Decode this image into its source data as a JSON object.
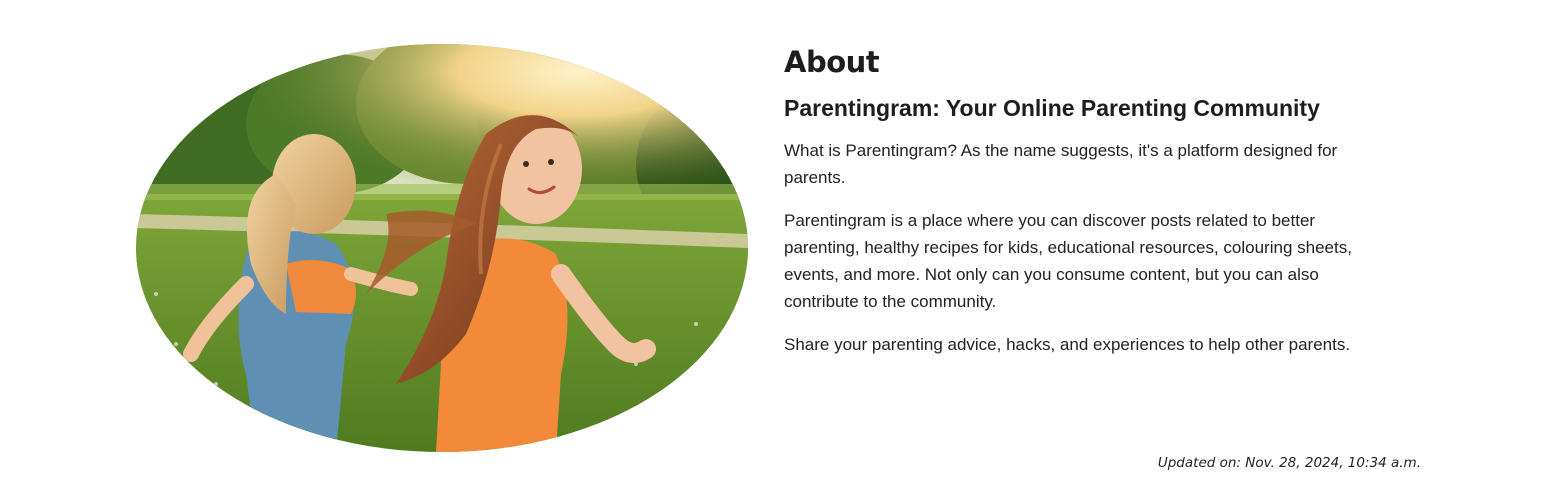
{
  "image": {
    "alt": "Two girls running on grass in a sunny park"
  },
  "about": {
    "heading": "About",
    "subheading": "Parentingram: Your Online Parenting Community",
    "paragraphs": [
      "What is Parentingram? As the name suggests, it's a platform designed for parents.",
      "Parentingram is a place where you can discover posts related to better parenting, healthy recipes for kids, educational resources, colouring sheets, events, and more. Not only can you consume content, but you can also contribute to the community.",
      "Share your parenting advice, hacks, and experiences to help other parents."
    ]
  },
  "footer": {
    "updated": "Updated on: Nov. 28, 2024, 10:34 a.m."
  }
}
